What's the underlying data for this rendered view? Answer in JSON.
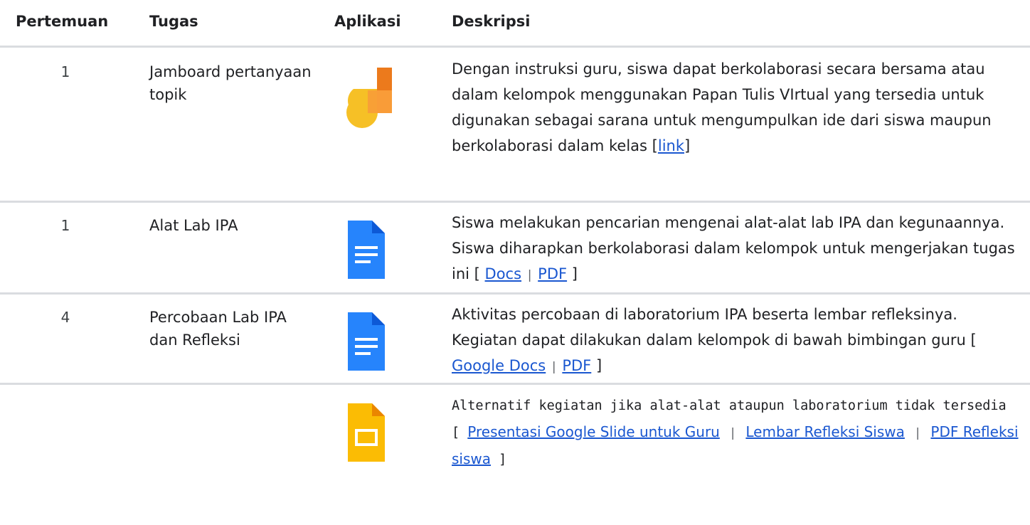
{
  "headers": {
    "meeting": "Pertemuan",
    "task": "Tugas",
    "app": "Aplikasi",
    "desc": "Deskripsi"
  },
  "rows": [
    {
      "meeting": "1",
      "task": "Jamboard pertanyaan topik",
      "app_icon": "jamboard-icon",
      "desc_text": "Dengan instruksi guru, siswa dapat berkolaborasi secara bersama atau dalam kelompok menggunakan Papan Tulis VIrtual yang tersedia untuk digunakan sebagai sarana untuk mengumpulkan ide dari siswa maupun berkolaborasi dalam kelas [",
      "links": [
        "link"
      ],
      "desc_end": "]"
    },
    {
      "meeting": "1",
      "task": "Alat Lab IPA",
      "app_icon": "google-docs-icon",
      "desc_text": "Siswa melakukan pencarian mengenai alat-alat lab IPA dan kegunaannya. Siswa diharapkan berkolaborasi dalam kelompok untuk mengerjakan tugas ini [ ",
      "links": [
        "Docs",
        "PDF"
      ],
      "desc_end": " ]"
    },
    {
      "meeting": "4",
      "task": "Percobaan Lab IPA dan Refleksi",
      "app_icon": "google-docs-icon",
      "desc_text": "Aktivitas percobaan di laboratorium IPA beserta lembar refleksinya. Kegiatan dapat dilakukan dalam kelompok di bawah bimbingan guru [ ",
      "links": [
        "Google Docs",
        "PDF"
      ],
      "desc_end": " ]"
    },
    {
      "meeting": "",
      "task": "",
      "app_icon": "google-slides-icon",
      "desc_text": "Alternatif kegiatan jika alat-alat ataupun laboratorium tidak tersedia [ ",
      "links": [
        "Presentasi Google Slide untuk Guru",
        "Lembar Refleksi Siswa",
        "PDF Refleksi siswa"
      ],
      "desc_end": " ]"
    }
  ],
  "separator": "|",
  "colors": {
    "link": "#1a57d0",
    "divider": "#dadce0",
    "docs_blue": "#4285f4",
    "slides_yellow": "#fbbc04",
    "jamboard_orange": "#f37c20"
  }
}
